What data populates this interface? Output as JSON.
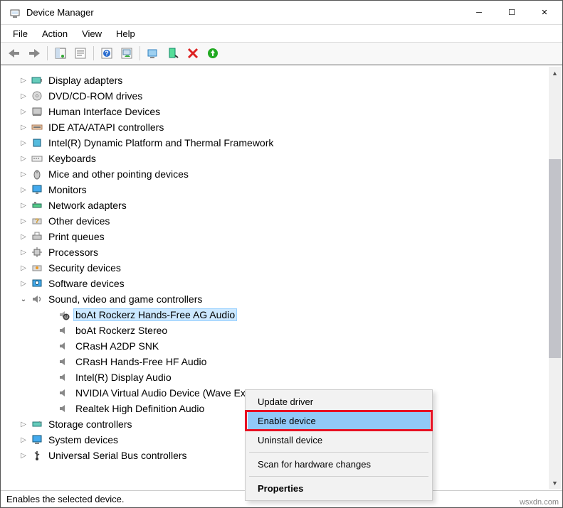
{
  "window": {
    "title": "Device Manager"
  },
  "menu": {
    "file": "File",
    "action": "Action",
    "view": "View",
    "help": "Help"
  },
  "status": {
    "text": "Enables the selected device."
  },
  "watermark": "wsxdn.com",
  "tree": {
    "display_adapters": "Display adapters",
    "dvd": "DVD/CD-ROM drives",
    "hid": "Human Interface Devices",
    "ide": "IDE ATA/ATAPI controllers",
    "intel_dptf": "Intel(R) Dynamic Platform and Thermal Framework",
    "keyboards": "Keyboards",
    "mice": "Mice and other pointing devices",
    "monitors": "Monitors",
    "network": "Network adapters",
    "other": "Other devices",
    "print": "Print queues",
    "processors": "Processors",
    "security": "Security devices",
    "software": "Software devices",
    "sound": "Sound, video and game controllers",
    "boat_hf": "boAt Rockerz Hands-Free AG Audio",
    "boat_stereo": "boAt Rockerz Stereo",
    "crash_a2dp": "CRasH A2DP SNK",
    "crash_hf": "CRasH Hands-Free HF Audio",
    "intel_display_audio": "Intel(R) Display Audio",
    "nvidia": "NVIDIA Virtual Audio Device (Wave Extensible) (WDM)",
    "realtek": "Realtek High Definition Audio",
    "storage": "Storage controllers",
    "system": "System devices",
    "usb": "Universal Serial Bus controllers"
  },
  "ctx": {
    "update": "Update driver",
    "enable": "Enable device",
    "uninstall": "Uninstall device",
    "scan": "Scan for hardware changes",
    "properties": "Properties"
  }
}
